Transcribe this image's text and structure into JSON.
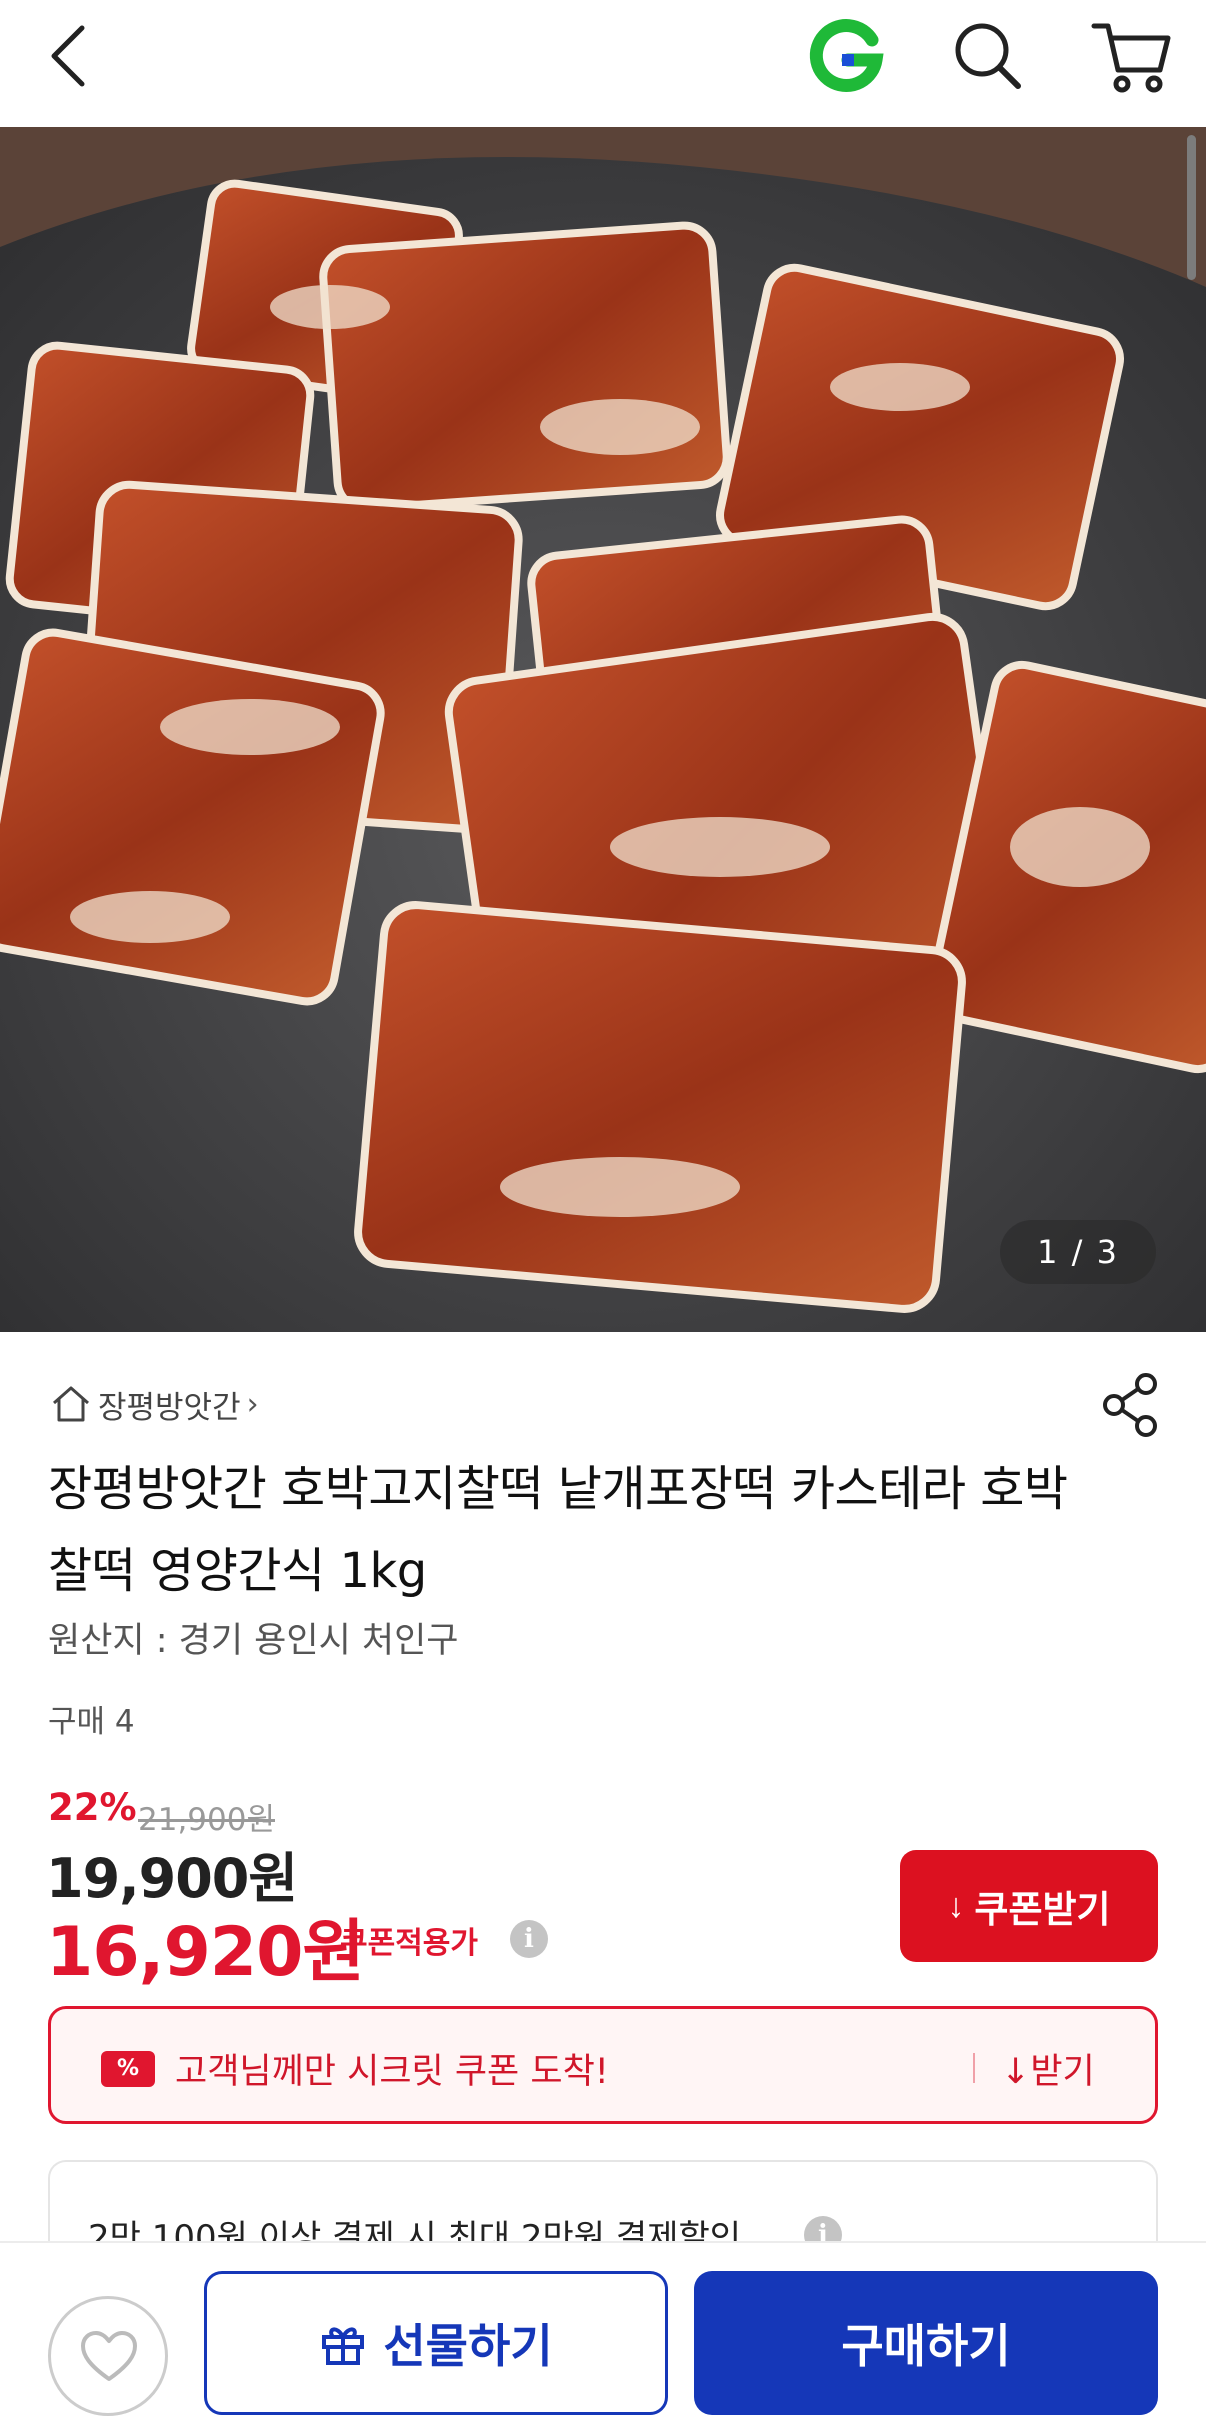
{
  "header": {
    "icons": [
      "back-icon",
      "gmarket-g-logo",
      "search-icon",
      "cart-icon"
    ]
  },
  "hero": {
    "counter": "1 / 3"
  },
  "product": {
    "shop_name": "장평방앗간",
    "title": "장평방앗간 호박고지찰떡 낱개포장떡 카스테라 호박찰떡 영양간식 1kg",
    "origin": "원산지 : 경기 용인시 처인구",
    "purchases": "구매 4"
  },
  "price": {
    "discount": "22%",
    "original": "21,900원",
    "sale": "19,900원",
    "coupon_price": "16,920원",
    "coupon_price_label": "쿠폰적용가",
    "coupon_button": "쿠폰받기"
  },
  "secret_coupon": {
    "tag": "%",
    "message": "고객님께만 시크릿 쿠폰 도착!",
    "action": "받기"
  },
  "payment_benefit": {
    "text": "2만 100원 이상 결제 시 최대 2만원 결제할인"
  },
  "bottom_bar": {
    "gift_label": "선물하기",
    "buy_label": "구매하기"
  },
  "colors": {
    "accent_red": "#e0162f",
    "brand_blue": "#1537b8",
    "gmarket_green": "#1fb938"
  }
}
